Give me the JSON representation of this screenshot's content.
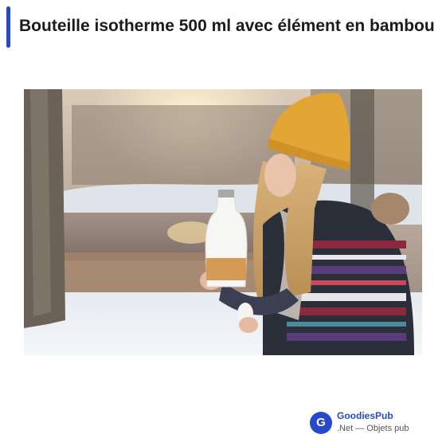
{
  "page": {
    "title": "Bouteille isotherme 500 ml avec élément en bambou",
    "accent_color": "#2748c9"
  },
  "photo": {
    "alt": "Femme au bonnet jaune tenant une bouteille isotherme blanche avec élément en bambou, dans un paysage enneigé"
  },
  "brand": {
    "logo_letter": "G",
    "name": "GoodiesPub",
    "subtitle": ".Net — Objets pub"
  }
}
